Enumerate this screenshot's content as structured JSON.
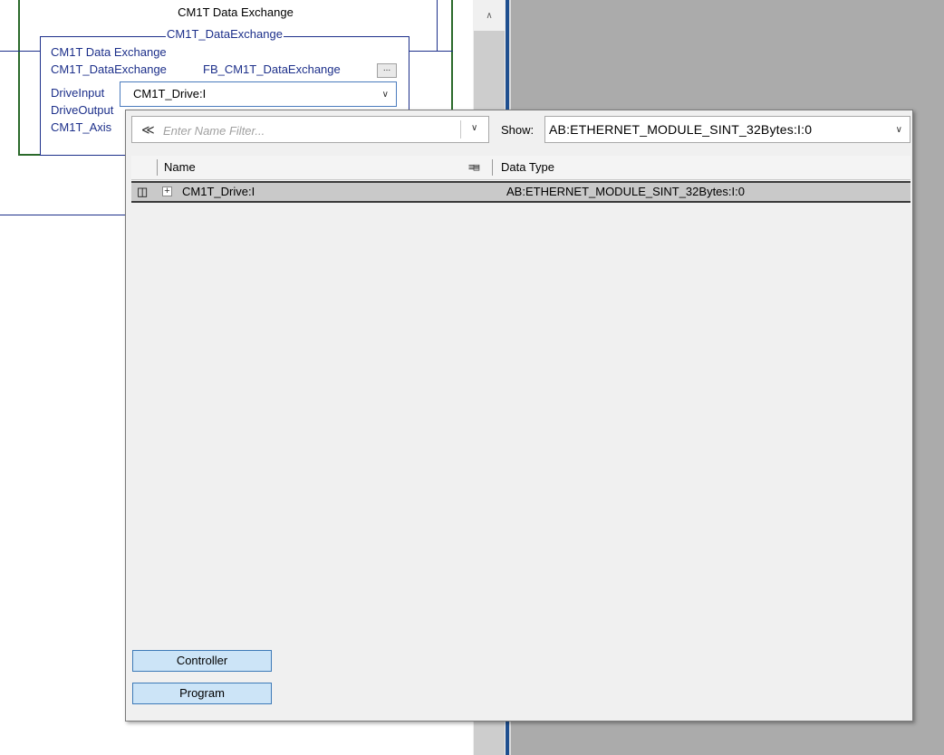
{
  "block": {
    "title": "CM1T Data Exchange",
    "instance_header": "CM1T_DataExchange",
    "description": "CM1T Data Exchange",
    "instance_name": "CM1T_DataExchange",
    "fb_type": "FB_CM1T_DataExchange",
    "ellipsis_label": "...",
    "params": [
      "DriveInput",
      "DriveOutput",
      "CM1T_Axis"
    ],
    "drive_input_value": "CM1T_Drive:I"
  },
  "popup": {
    "filter_placeholder": "Enter Name Filter...",
    "show_label": "Show:",
    "show_value": "AB:ETHERNET_MODULE_SINT_32Bytes:I:0",
    "columns": {
      "name": "Name",
      "data_type": "Data Type"
    },
    "rows": [
      {
        "name": "CM1T_Drive:I",
        "data_type": "AB:ETHERNET_MODULE_SINT_32Bytes:I:0",
        "expander": "+"
      }
    ],
    "scope_buttons": [
      "Controller",
      "Program"
    ]
  },
  "icons": {
    "filter": "filter-icon",
    "dropdown": "chevron-down-icon",
    "scroll_up": "chevron-up-icon",
    "column_chooser": "column-chooser-icon",
    "row_marker": "row-marker-icon",
    "expand": "plus-box-icon"
  },
  "colors": {
    "ladder_blue": "#1c2f8a",
    "rung_green": "#2b6a2b",
    "selection_blue": "#cce4f7",
    "background_gray": "#ababab"
  }
}
